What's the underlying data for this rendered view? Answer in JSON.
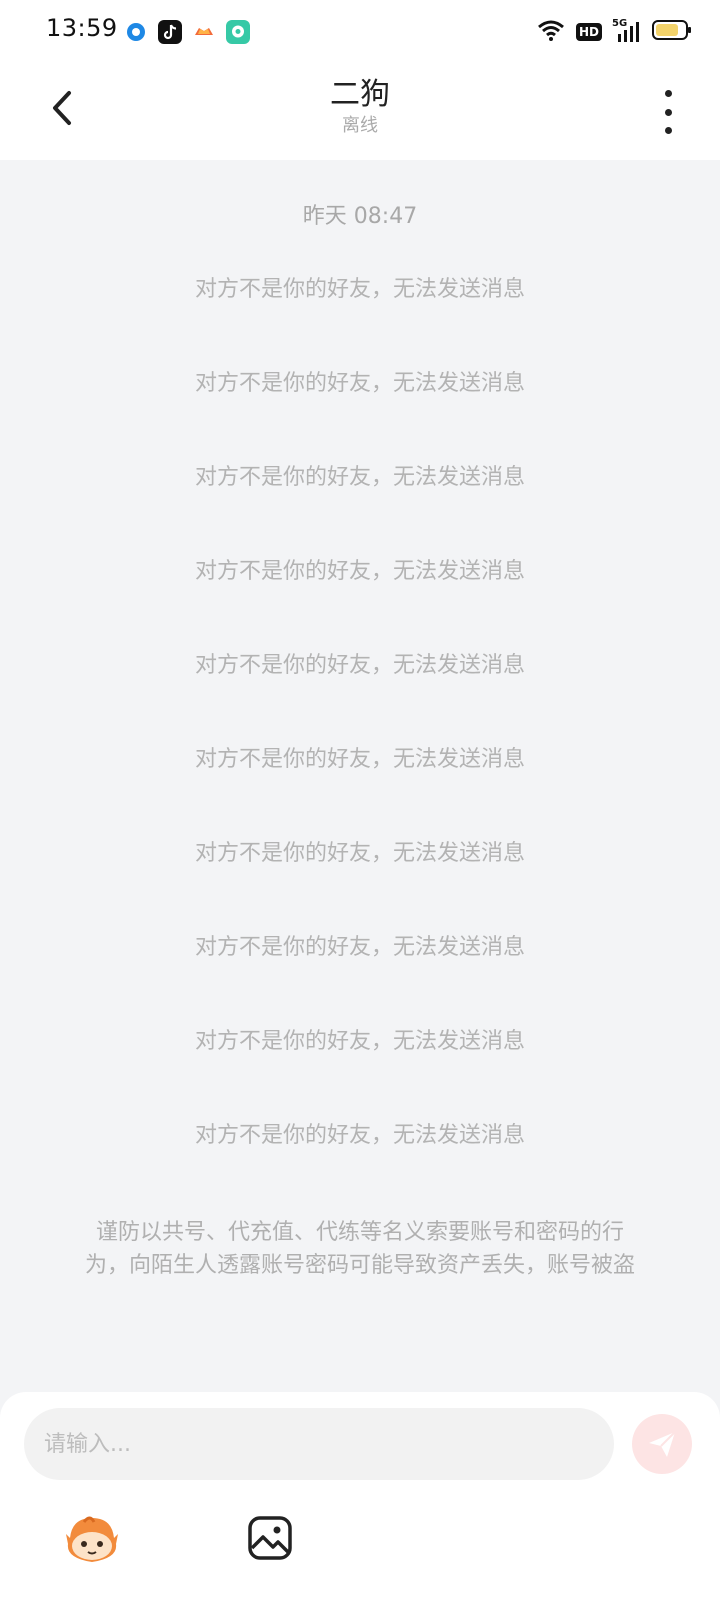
{
  "status_bar": {
    "time": "13:59",
    "hd": "HD",
    "network": "5G",
    "icons": [
      "notification-app-icon",
      "tiktok-icon",
      "game-icon",
      "chat-app-icon",
      "wifi-icon",
      "signal-icon",
      "battery-icon"
    ]
  },
  "header": {
    "title": "二狗",
    "subtitle": "离线"
  },
  "chat": {
    "timestamp": "昨天 08:47",
    "system_messages": [
      "对方不是你的好友，无法发送消息",
      "对方不是你的好友，无法发送消息",
      "对方不是你的好友，无法发送消息",
      "对方不是你的好友，无法发送消息",
      "对方不是你的好友，无法发送消息",
      "对方不是你的好友，无法发送消息",
      "对方不是你的好友，无法发送消息",
      "对方不是你的好友，无法发送消息",
      "对方不是你的好友，无法发送消息",
      "对方不是你的好友，无法发送消息"
    ],
    "warning_line1": "谨防以共号、代充值、代练等名义索要账号和密码的行",
    "warning_line2": "为，向陌生人透露账号密码可能导致资产丢失，账号被盗"
  },
  "input": {
    "placeholder": "请输入..."
  },
  "colors": {
    "background": "#f3f4f6",
    "send_button": "#fde4e4",
    "send_icon": "#ffffff"
  }
}
